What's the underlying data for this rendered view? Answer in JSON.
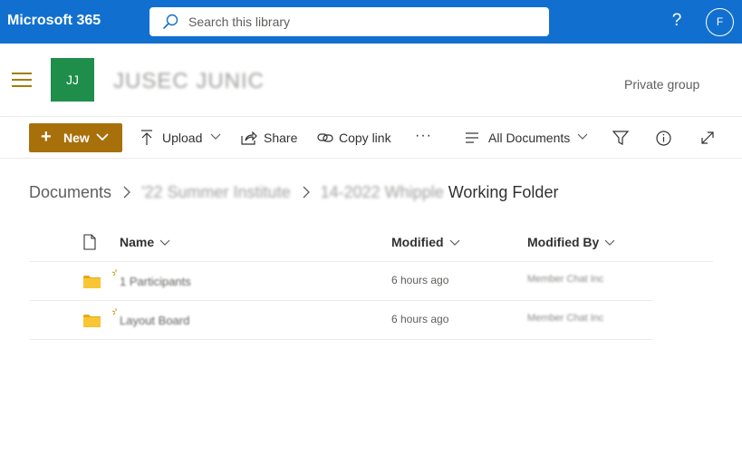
{
  "suite": {
    "brand": "Microsoft 365",
    "search_placeholder": "Search this library",
    "help": "?",
    "avatar_initial": "F"
  },
  "site": {
    "logo_initials": "JJ",
    "title": "JUSEC JUNIC",
    "privacy": "Private group"
  },
  "commandbar": {
    "new_label": "New",
    "upload_label": "Upload",
    "share_label": "Share",
    "copy_link_label": "Copy link",
    "more_label": "···",
    "view_label": "All Documents"
  },
  "breadcrumb": {
    "root": "Documents",
    "sep": ">",
    "middle": "'22 Summer Institute",
    "current_prefix": "14-2022 Whipple",
    "current": "Working Folder"
  },
  "table": {
    "headers": {
      "name": "Name",
      "modified": "Modified",
      "modified_by": "Modified By"
    },
    "rows": [
      {
        "name": "1 Participants",
        "modified": "6 hours ago",
        "modified_by": "Member Chat Inc"
      },
      {
        "name": "Layout Board",
        "modified": "6 hours ago",
        "modified_by": "Member Chat Inc"
      }
    ]
  },
  "colors": {
    "suite_bar": "#1170cf",
    "accent": "#a8700a",
    "site_logo": "#1e8e4a",
    "folder": "#f8c535"
  }
}
